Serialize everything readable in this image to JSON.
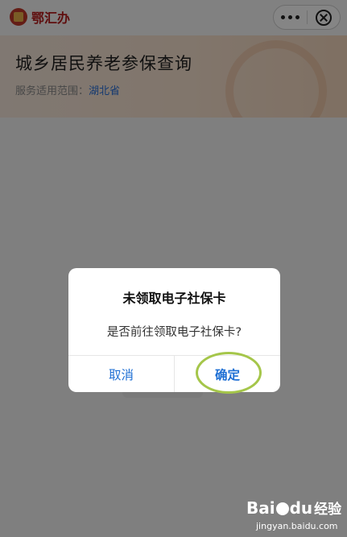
{
  "app": {
    "logo_text": "鄂汇办"
  },
  "capsule": {
    "more_icon": "more-dots-icon",
    "close_icon": "close-circle-icon"
  },
  "header": {
    "title": "城乡居民养老参保查询",
    "scope_label": "服务适用范围：",
    "scope_value": "湖北省"
  },
  "dialog": {
    "title": "未领取电子社保卡",
    "message": "是否前往领取电子社保卡?",
    "cancel_label": "取消",
    "confirm_label": "确定"
  },
  "watermark": {
    "brand_left": "Bai",
    "brand_right": "du",
    "brand_cn": "经验",
    "url": "jingyan.baidu.com"
  },
  "colors": {
    "accent": "#1e6fd4",
    "highlight_ring": "#a5c64a",
    "logo_red": "#b71c1c"
  }
}
